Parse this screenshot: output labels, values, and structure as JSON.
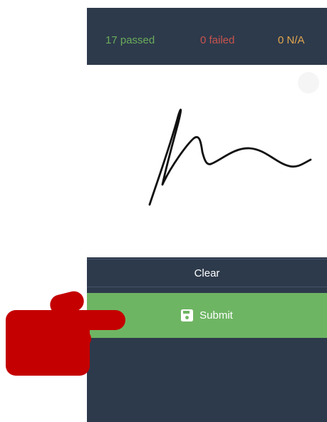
{
  "stats": {
    "passed": "17 passed",
    "failed": "0 failed",
    "na": "0 N/A"
  },
  "signature": {
    "present": true
  },
  "buttons": {
    "clear_label": "Clear",
    "submit_label": "Submit"
  },
  "icons": {
    "submit_icon": "floppy-disk-icon",
    "pointer": "pointing-hand-icon"
  },
  "colors": {
    "panel": "#2d3a4b",
    "passed": "#6aac5c",
    "failed": "#c9534f",
    "na": "#e2a54e",
    "submit": "#6eb563",
    "pointer": "#c40000"
  }
}
